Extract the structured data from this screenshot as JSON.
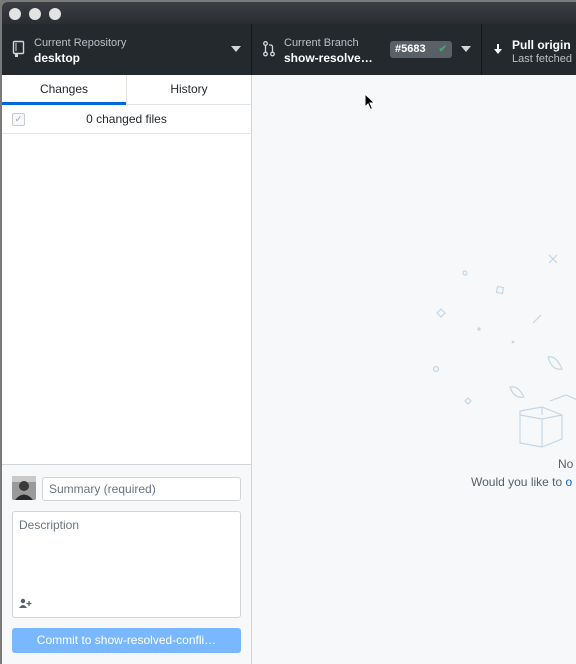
{
  "toolbar": {
    "repository": {
      "label": "Current Repository",
      "value": "desktop"
    },
    "branch": {
      "label": "Current Branch",
      "value": "show-resolve…",
      "pr_number": "#5683"
    },
    "pull": {
      "label": "Pull origin",
      "sublabel": "Last fetched"
    }
  },
  "sidebar": {
    "tabs": [
      {
        "label": "Changes",
        "active": true
      },
      {
        "label": "History",
        "active": false
      }
    ],
    "changes_count": "0 changed files"
  },
  "commit": {
    "summary_placeholder": "Summary (required)",
    "description_placeholder": "Description",
    "button_label": "Commit to show-resolved-confli…"
  },
  "blank_slate": {
    "line1": "No",
    "line2_prefix": "Would you like to",
    "line2_link": "o"
  },
  "colors": {
    "toolbar_bg": "#24292e",
    "accent": "#0366d6",
    "commit_button": "#79b8ff"
  }
}
